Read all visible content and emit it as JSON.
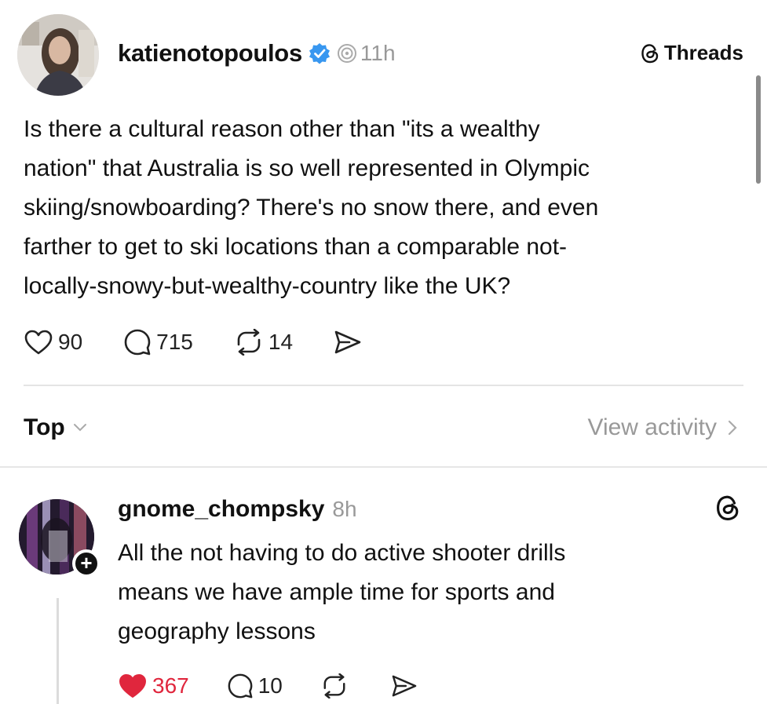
{
  "post": {
    "username": "katienotopoulos",
    "timestamp": "11h",
    "brand": "Threads",
    "body": "Is there a cultural reason other than \"its a wealthy\nnation\" that Australia is so well represented in Olympic\nskiing/snowboarding? There's no snow there, and even\nfarther to get to ski locations than a comparable not-\nlocally-snowy-but-wealthy-country like the UK?",
    "likes": "90",
    "replies": "715",
    "reposts": "14"
  },
  "sort": {
    "label": "Top",
    "view_activity": "View activity"
  },
  "reply": {
    "username": "gnome_chompsky",
    "timestamp": "8h",
    "follow_symbol": "+",
    "body": "All the not having to do active shooter drills\nmeans we have ample time for sports and\ngeography lessons",
    "likes": "367",
    "replies": "10",
    "liked": true
  },
  "colors": {
    "accent_like": "#e0263d",
    "verified_blue": "#3897f0",
    "muted_text": "#999999"
  },
  "icons": {
    "verified": "verified-badge-icon",
    "like": "heart-icon",
    "reply": "comment-icon",
    "repost": "repost-icon",
    "share": "share-icon",
    "threads": "threads-logo-icon",
    "fediverse": "fediverse-icon"
  }
}
